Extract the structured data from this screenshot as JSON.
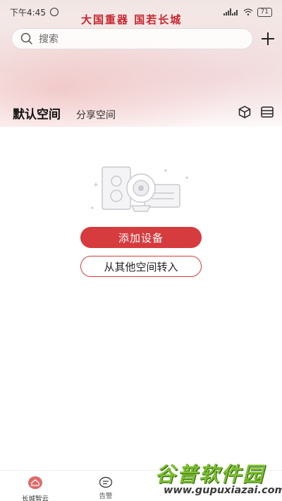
{
  "status_bar": {
    "time": "下午4:45",
    "battery": "71",
    "slogan": "大国重器 国若长城"
  },
  "search": {
    "placeholder": "搜索",
    "icon": "search-icon",
    "add_icon": "plus-icon"
  },
  "tabs": [
    {
      "label": "默认空间",
      "active": true
    },
    {
      "label": "分享空间",
      "active": false
    }
  ],
  "toolbar_icons": [
    "cube-icon",
    "list-icon"
  ],
  "empty_state": {
    "illustration": "devices-illustration",
    "add_device_label": "添加设备",
    "transfer_label": "从其他空间转入"
  },
  "bottom_nav": [
    {
      "label": "长城智云",
      "icon": "home-icon",
      "active": true
    },
    {
      "label": "告警",
      "icon": "chat-icon",
      "active": false
    }
  ],
  "watermark": {
    "title": "谷普软件园",
    "url": "www.gupuxiazai.com"
  },
  "colors": {
    "accent": "#d63b3d",
    "slogan": "#c8262e",
    "watermark_green": "#7bbf2e"
  }
}
